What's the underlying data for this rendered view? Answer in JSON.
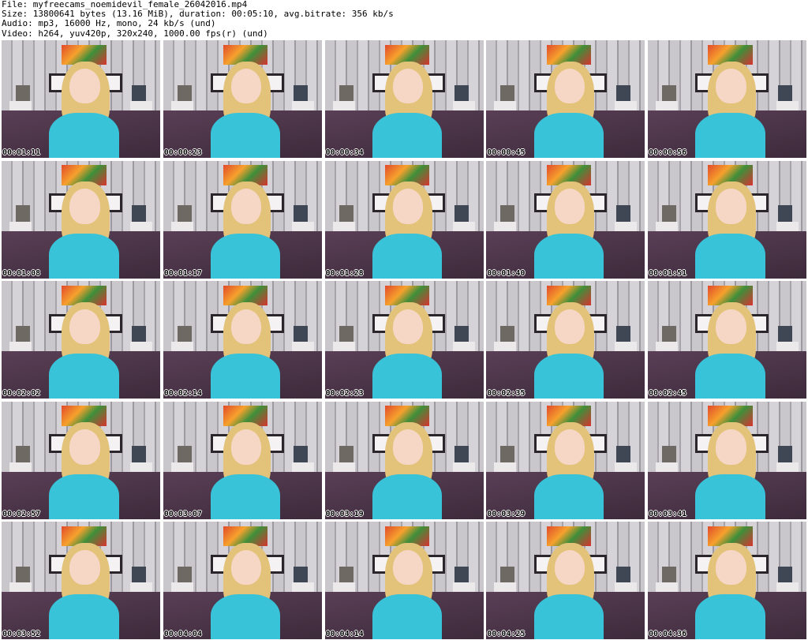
{
  "header": {
    "file_line": "File: myfreecams_noemidevil_female_26042016.mp4",
    "size_line": "Size: 13800641 bytes (13.16 MiB), duration: 00:05:10, avg.bitrate: 356 kb/s",
    "audio_line": "Audio: mp3, 16000 Hz, mono, 24 kb/s (und)",
    "video_line": "Video: h264, yuv420p, 320x240, 1000.00 fps(r) (und)"
  },
  "thumbnails": [
    {
      "timestamp": "00:01:11"
    },
    {
      "timestamp": "00:00:23"
    },
    {
      "timestamp": "00:00:34"
    },
    {
      "timestamp": "00:00:45"
    },
    {
      "timestamp": "00:00:56"
    },
    {
      "timestamp": "00:01:08"
    },
    {
      "timestamp": "00:01:17"
    },
    {
      "timestamp": "00:01:28"
    },
    {
      "timestamp": "00:01:40"
    },
    {
      "timestamp": "00:01:51"
    },
    {
      "timestamp": "00:02:02"
    },
    {
      "timestamp": "00:02:14"
    },
    {
      "timestamp": "00:02:23"
    },
    {
      "timestamp": "00:02:35"
    },
    {
      "timestamp": "00:02:45"
    },
    {
      "timestamp": "00:02:57"
    },
    {
      "timestamp": "00:03:07"
    },
    {
      "timestamp": "00:03:19"
    },
    {
      "timestamp": "00:03:29"
    },
    {
      "timestamp": "00:03:41"
    },
    {
      "timestamp": "00:03:52"
    },
    {
      "timestamp": "00:04:04"
    },
    {
      "timestamp": "00:04:14"
    },
    {
      "timestamp": "00:04:25"
    },
    {
      "timestamp": "00:04:36"
    }
  ]
}
